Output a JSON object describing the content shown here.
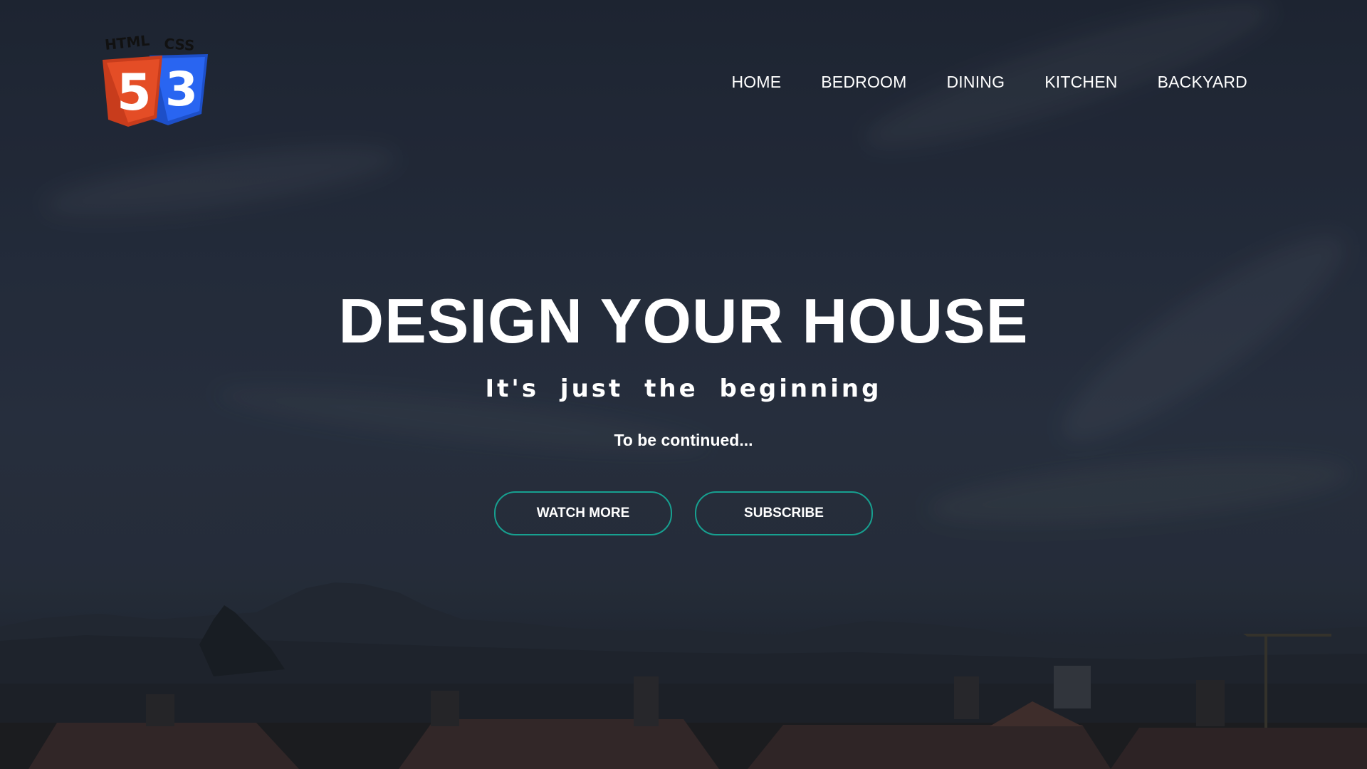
{
  "logo": {
    "label_left": "HTML",
    "label_right": "CSS",
    "html_number": "5",
    "css_number": "3",
    "html_color": "#e44d26",
    "css_color": "#2965f1",
    "icon": "html5-css3-logo-icon"
  },
  "nav": {
    "items": [
      "HOME",
      "BEDROOM",
      "DINING",
      "KITCHEN",
      "BACKYARD"
    ]
  },
  "hero": {
    "headline": "DESIGN YOUR HOUSE",
    "subheadline": "It's just the beginning",
    "tagline": "To be continued..."
  },
  "buttons": {
    "watch_more": "WATCH MORE",
    "subscribe": "SUBSCRIBE",
    "border_color": "#17a090"
  },
  "background": {
    "description_icon": "city-skyline-background"
  }
}
